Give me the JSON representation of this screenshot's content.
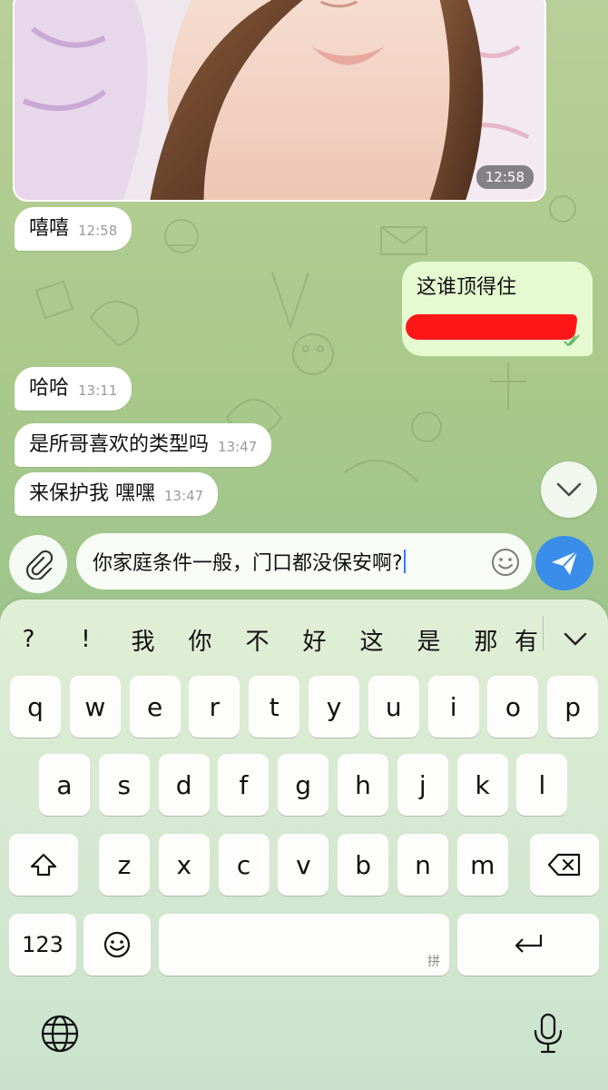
{
  "photo_message": {
    "time": "12:58"
  },
  "messages": [
    {
      "direction": "in",
      "text": "嘻嘻",
      "time": "12:58"
    },
    {
      "direction": "out",
      "text": "这谁顶得住"
    },
    {
      "direction": "in",
      "text": "哈哈",
      "time": "13:11"
    },
    {
      "direction": "in",
      "text": "是所哥喜欢的类型吗",
      "time": "13:47"
    },
    {
      "direction": "in",
      "text": "来保护我 嘿嘿",
      "time": "13:47"
    }
  ],
  "composer": {
    "input_value": "你家庭条件一般，门口都没保安啊?",
    "attach_icon": "paperclip-icon",
    "emoji_icon": "smiley-icon",
    "send_icon": "send-arrow-icon",
    "send_color": "#3a8eea"
  },
  "keyboard": {
    "candidates": [
      "?",
      "!",
      "我",
      "你",
      "不",
      "好",
      "这",
      "是",
      "那",
      "有"
    ],
    "row1": [
      "q",
      "w",
      "e",
      "r",
      "t",
      "y",
      "u",
      "i",
      "o",
      "p"
    ],
    "row2": [
      "a",
      "s",
      "d",
      "f",
      "g",
      "h",
      "j",
      "k",
      "l"
    ],
    "row3": [
      "z",
      "x",
      "c",
      "v",
      "b",
      "n",
      "m"
    ],
    "numbers_label": "123",
    "space_ime_label": "拼",
    "globe_icon": "globe-icon",
    "mic_icon": "microphone-icon"
  },
  "colors": {
    "outgoing_bubble": "#e6fad2",
    "incoming_bubble": "#ffffff",
    "redaction": "#ff1616"
  }
}
